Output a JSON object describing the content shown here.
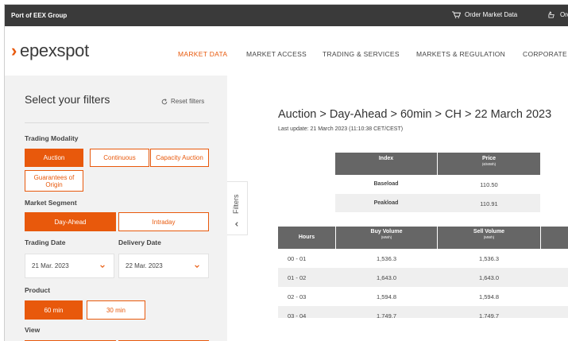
{
  "topbar": {
    "group": "Port of EEX Group",
    "order_label": "Order Market Data",
    "order_cut": "Ord"
  },
  "header": {
    "logo": "epexspot",
    "nav": [
      {
        "label": "MARKET DATA",
        "active": true
      },
      {
        "label": "MARKET ACCESS",
        "active": false
      },
      {
        "label": "TRADING & SERVICES",
        "active": false
      },
      {
        "label": "MARKETS & REGULATION",
        "active": false
      },
      {
        "label": "CORPORATE",
        "active": false
      }
    ]
  },
  "sidebar": {
    "title": "Select your filters",
    "reset": "Reset filters",
    "trading_modality": {
      "label": "Trading Modality",
      "options": [
        "Auction",
        "Continuous",
        "Capacity Auction",
        "Guarantees of Origin"
      ],
      "selected": "Auction"
    },
    "market_segment": {
      "label": "Market Segment",
      "options": [
        "Day-Ahead",
        "Intraday"
      ],
      "selected": "Day-Ahead"
    },
    "trading_date": {
      "label": "Trading Date",
      "value": "21 Mar. 2023"
    },
    "delivery_date": {
      "label": "Delivery Date",
      "value": "22 Mar. 2023"
    },
    "product": {
      "label": "Product",
      "options": [
        "60 min",
        "30 min"
      ],
      "selected": "60 min"
    },
    "view": {
      "label": "View"
    },
    "filters_tab": "Filters"
  },
  "main": {
    "title": "Auction > Day-Ahead > 60min > CH > 22 March 2023",
    "last_update": "Last update: 21 March 2023 (11:10:38 CET/CEST)",
    "index_table": {
      "headers": [
        {
          "label": "Index",
          "unit": ""
        },
        {
          "label": "Price",
          "unit": "(€/MWh)"
        }
      ],
      "rows": [
        {
          "index": "Baseload",
          "price": "110.50"
        },
        {
          "index": "Peakload",
          "price": "110.91"
        }
      ]
    },
    "hours_table": {
      "headers": [
        {
          "label": "Hours",
          "unit": ""
        },
        {
          "label": "Buy Volume",
          "unit": "(MWh)"
        },
        {
          "label": "Sell Volume",
          "unit": "(MWh)"
        }
      ],
      "rows": [
        {
          "hours": "00 - 01",
          "buy": "1,536.3",
          "sell": "1,536.3"
        },
        {
          "hours": "01 - 02",
          "buy": "1,643.0",
          "sell": "1,643.0"
        },
        {
          "hours": "02 - 03",
          "buy": "1,594.8",
          "sell": "1,594.8"
        },
        {
          "hours": "03 - 04",
          "buy": "1,749.7",
          "sell": "1,749.7"
        }
      ]
    }
  },
  "colors": {
    "accent": "#e8590c",
    "topbar": "#3a3a3a",
    "table_header": "#666666",
    "sidebar_bg": "#f2f2f2"
  }
}
